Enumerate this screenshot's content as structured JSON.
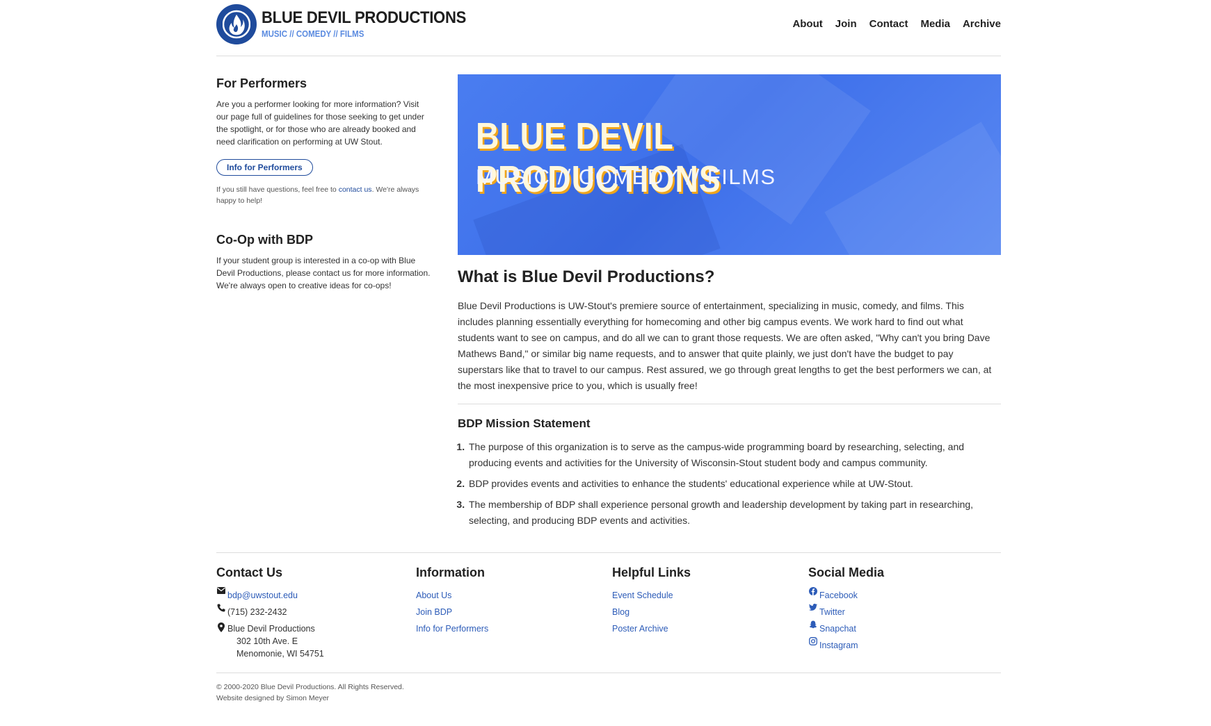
{
  "header": {
    "brand_title": "BLUE DEVIL PRODUCTIONS",
    "brand_subtitle": "MUSIC // COMEDY // FILMS",
    "nav": [
      "About",
      "Join",
      "Contact",
      "Media",
      "Archive"
    ]
  },
  "sidebar": {
    "performers": {
      "title": "For Performers",
      "text": "Are you a performer looking for more information? Visit our page full of guidelines for those seeking to get under the spotlight, or for those who are already booked and need clarification on performing at UW Stout.",
      "button": "Info for Performers",
      "note_before": "If you still have questions, feel free to ",
      "note_link": "contact us",
      "note_after": ". We're always happy to help!"
    },
    "coop": {
      "title": "Co-Op with BDP",
      "text": "If your student group is interested in a co-op with Blue Devil Productions, please contact us for more information. We're always open to creative ideas for co-ops!"
    }
  },
  "banner": {
    "title": "BLUE DEVIL PRODUCTIONS",
    "subtitle": "MUSIC // COMEDY // FILMS"
  },
  "main": {
    "heading": "What is Blue Devil Productions?",
    "intro": "Blue Devil Productions is UW-Stout's premiere source of entertainment, specializing in music, comedy, and films. This includes planning essentially everything for homecoming and other big campus events. We work hard to find out what students want to see on campus, and do all we can to grant those requests. We are often asked, \"Why can't you bring Dave Mathews Band,\" or similar big name requests, and to answer that quite plainly, we just don't have the budget to pay superstars like that to travel to our campus. Rest assured, we go through great lengths to get the best performers we can, at the most inexpensive price to you, which is usually free!",
    "mission_title": "BDP Mission Statement",
    "mission": [
      "The purpose of this organization is to serve as the campus-wide programming board by researching, selecting, and producing events and activities for the University of Wisconsin-Stout student body and campus community.",
      "BDP provides events and activities to enhance the students' educational experience while at UW-Stout.",
      "The membership of BDP shall experience personal growth and leadership development by taking part in researching, selecting, and producing BDP events and activities."
    ]
  },
  "footer": {
    "contact": {
      "title": "Contact Us",
      "email": "bdp@uwstout.edu",
      "phone": "(715) 232-2432",
      "address": [
        "Blue Devil Productions",
        "302 10th Ave. E",
        "Menomonie, WI 54751"
      ]
    },
    "information": {
      "title": "Information",
      "links": [
        "About Us",
        "Join BDP",
        "Info for Performers"
      ]
    },
    "helpful": {
      "title": "Helpful Links",
      "links": [
        "Event Schedule",
        "Blog",
        "Poster Archive"
      ]
    },
    "social": {
      "title": "Social Media",
      "links": [
        "Facebook",
        "Twitter",
        "Snapchat",
        "Instagram"
      ]
    },
    "copyright": "© 2000-2020 Blue Devil Productions. All Rights Reserved.",
    "credit": "Website designed by Simon Meyer"
  },
  "colors": {
    "brand_blue": "#1f4b9c",
    "link_blue": "#2d5cb8",
    "banner_blue": "#4a7df0",
    "banner_shadow": "#f0a51b"
  }
}
